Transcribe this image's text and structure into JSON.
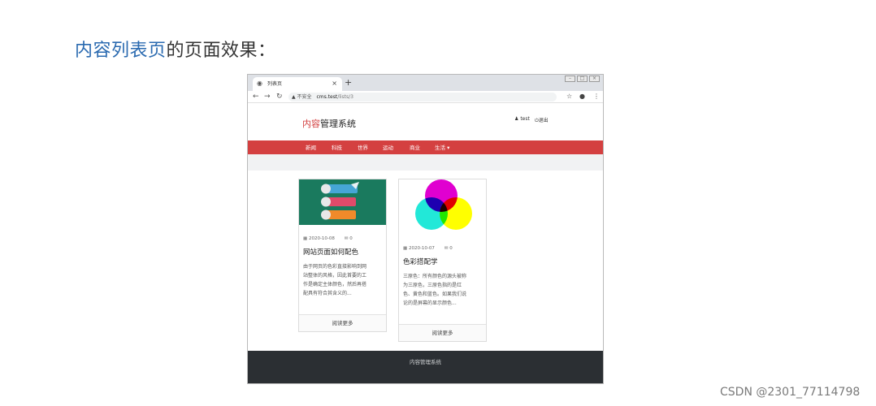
{
  "heading": {
    "link_text": "内容列表页",
    "rest_text": "的页面效果："
  },
  "browser": {
    "tab_title": "列表页",
    "tab_close": "×",
    "new_tab": "+",
    "url_warning": "不安全",
    "url_host": "cms.test",
    "url_path": "/lists/3"
  },
  "site": {
    "brand_accent": "内容",
    "brand_rest": "管理系统",
    "user_name": "test",
    "logout": "退出",
    "nav": [
      "新闻",
      "科技",
      "世界",
      "运动",
      "商业",
      "生活"
    ],
    "footer": "内容管理系统"
  },
  "cards": [
    {
      "date": "2020-10-08",
      "comments": "0",
      "title": "网站页面如何配色",
      "desc_lines": [
        "由于网页的色彩直接影响到网",
        "站整体的风格，因此首要的工",
        "作是确定主体颜色，然后再搭",
        "配具有符合其含义的..."
      ],
      "more": "阅读更多",
      "image": "infographic-banners-image"
    },
    {
      "date": "2020-10-07",
      "comments": "0",
      "title": "色彩搭配学",
      "desc_lines": [
        "三原色：所有颜色的源头被称",
        "为三原色，三原色指的是红",
        "色、黄色和蓝色。如果我们说",
        "论的是屏幕的显示颜色..."
      ],
      "more": "阅读更多",
      "image": "color-circles-image"
    }
  ],
  "colors": {
    "accent_red": "#d44040",
    "heading_link": "#2a6ab0",
    "footer_bg": "#2b2f33",
    "card_green": "#1a7a5e"
  },
  "watermark": "CSDN @2301_77114798"
}
